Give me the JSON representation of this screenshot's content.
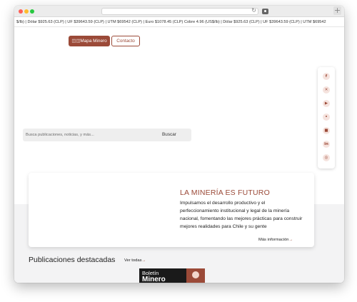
{
  "ticker": {
    "text": "$/lb) | Dólar $925.63 (CLP) | UF $39643.59 (CLP) | UTM $69542 (CLP) | Euro $1078.45 (CLP) Cobre 4.96 (US$/lb) | Dólar $925.63 (CLP) | UF $39643.59 (CLP) | UTM $69542"
  },
  "nav": {
    "mapa_label": "◫◫Mapa Minero",
    "contacto_label": "Contacto"
  },
  "search": {
    "placeholder": "Busca publicaciones, noticias, y más...",
    "button_label": "Buscar"
  },
  "social": [
    {
      "icon": "facebook-icon",
      "glyph": "f"
    },
    {
      "icon": "x-icon",
      "glyph": "✕"
    },
    {
      "icon": "youtube-icon",
      "glyph": "▶"
    },
    {
      "icon": "podcast-icon",
      "glyph": "•"
    },
    {
      "icon": "video-icon",
      "glyph": "■"
    },
    {
      "icon": "linkedin-icon",
      "glyph": "in"
    },
    {
      "icon": "instagram-icon",
      "glyph": "◎"
    }
  ],
  "feature": {
    "title": "LA MINERÍA ES FUTURO",
    "text": "Impulsamos el desarrollo productivo y el perfeccionamiento institucional y legal de la minería nacional, fomentando las mejores prácticas para construir mejores realidades para Chile y su gente",
    "more_label": "Más información",
    "more_arrow": "→"
  },
  "publications": {
    "title": "Publicaciones destacadas",
    "see_all_label": "Ver todas",
    "see_all_arrow": "→",
    "boletin_line1": "Boletín",
    "boletin_line2": "Minero"
  },
  "colors": {
    "accent": "#9b4a38",
    "lower_bg": "#f3f3f4"
  }
}
